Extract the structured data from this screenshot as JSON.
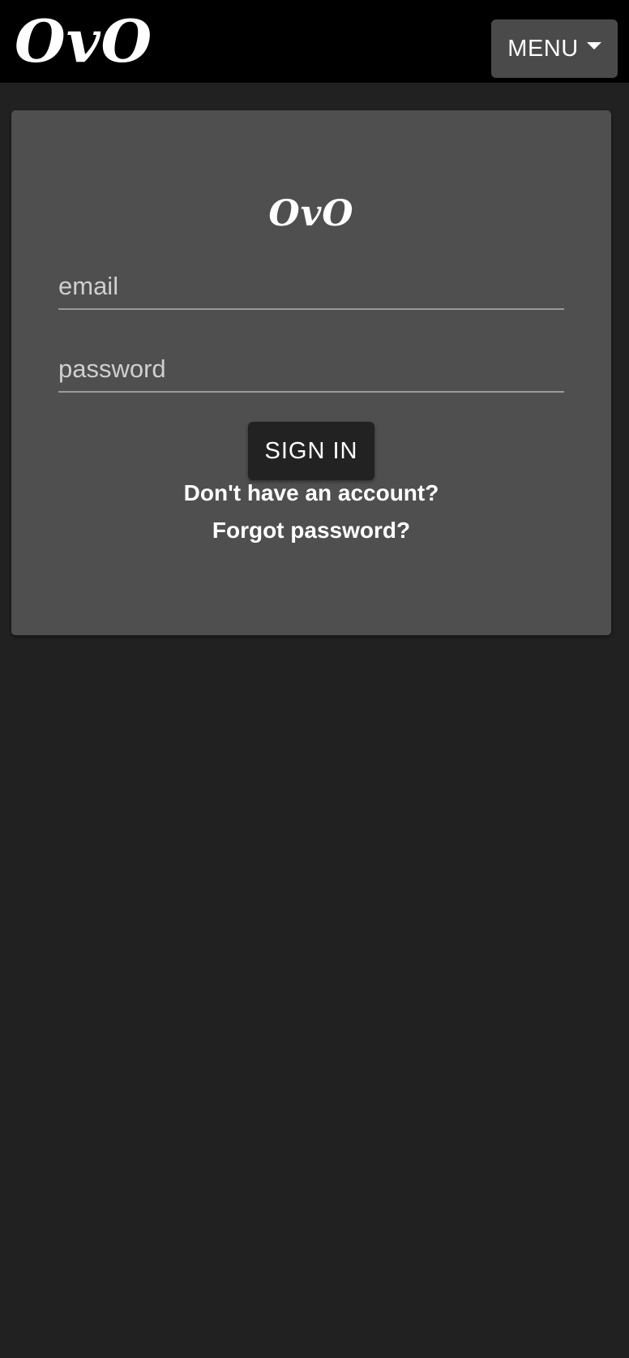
{
  "header": {
    "brand": "OvO",
    "menu_label": "MENU"
  },
  "login_card": {
    "logo": "OvO",
    "email_placeholder": "email",
    "email_value": "",
    "password_placeholder": "password",
    "password_value": "",
    "signin_label": "SIGN IN",
    "register_link": "Don't have an account?",
    "forgot_link": "Forgot password?"
  },
  "icons": {
    "menu_caret": "caret-down-icon"
  },
  "colors": {
    "page_background": "#212121",
    "topbar_background": "#000000",
    "card_background": "#4f4f4f",
    "menu_button": "#4a4a4a",
    "signin_button": "#222222",
    "text": "#ffffff"
  }
}
